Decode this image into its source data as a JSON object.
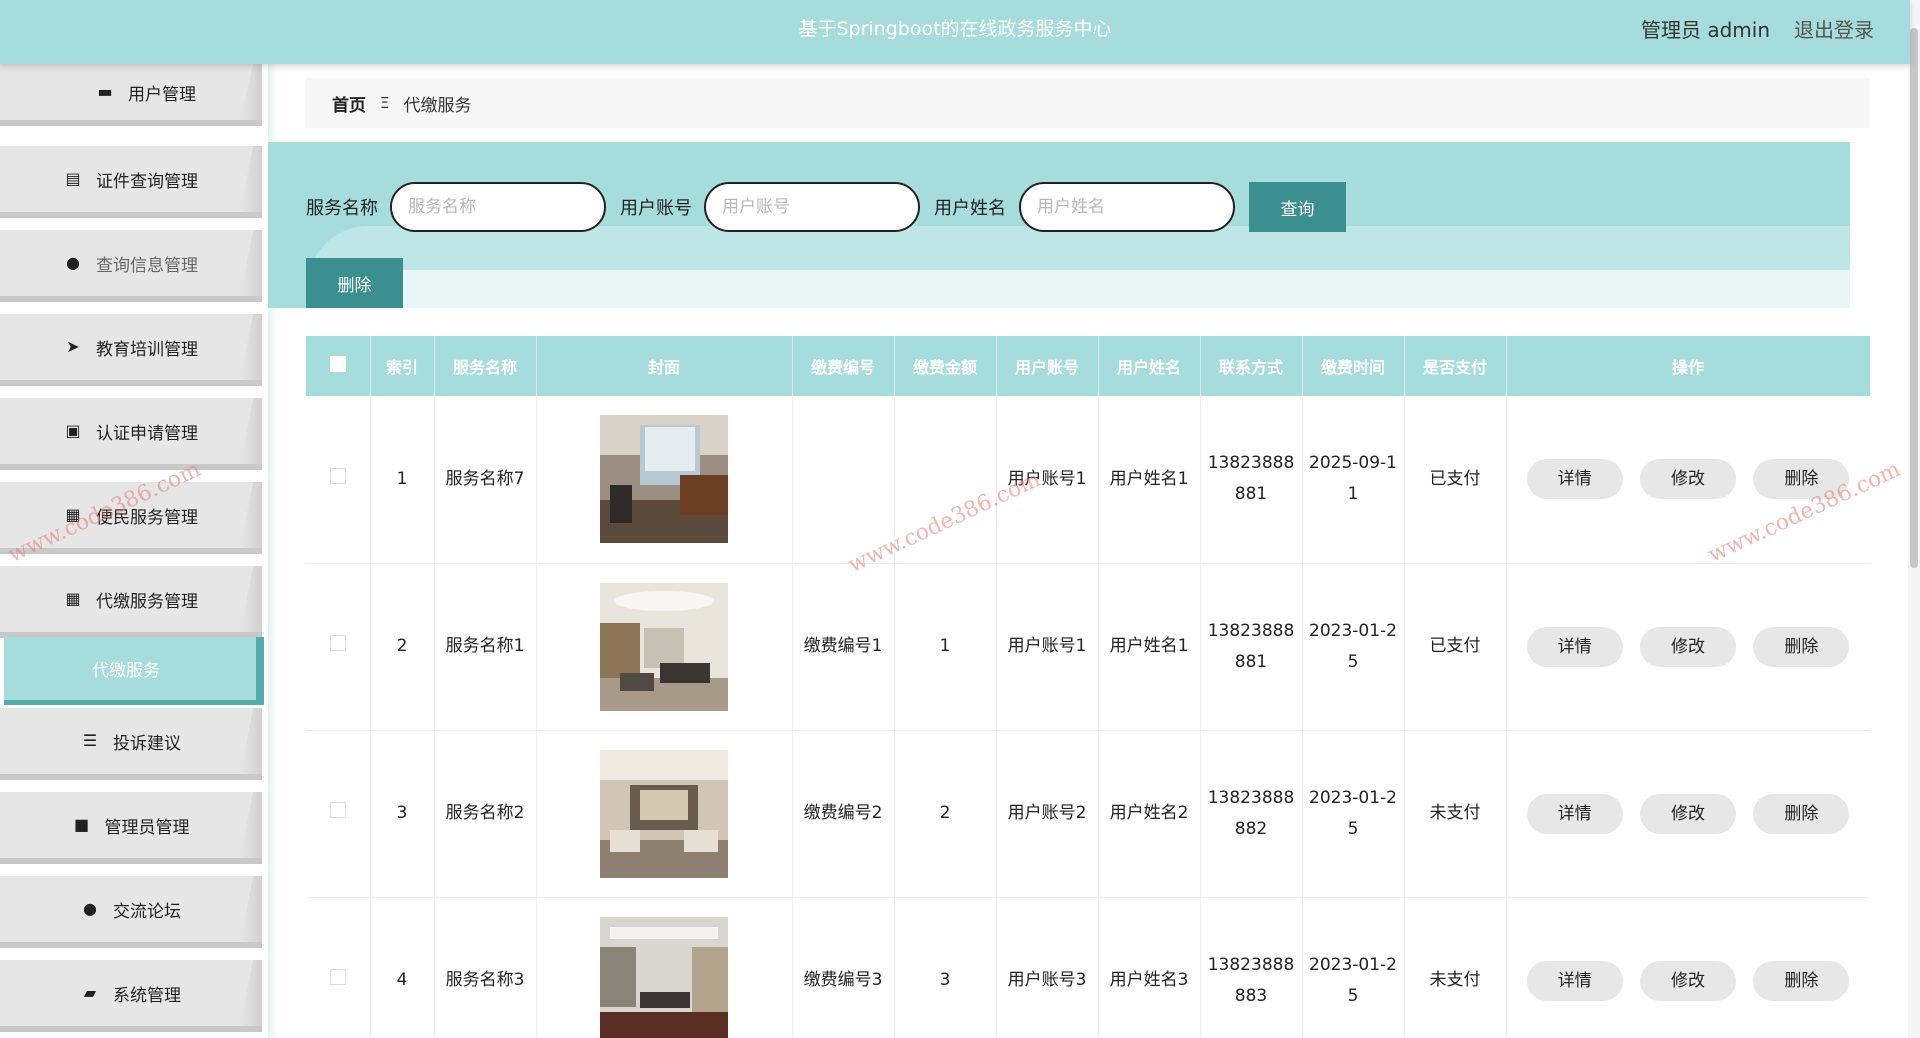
{
  "header": {
    "title": "基于Springboot的在线政务服务中心",
    "user": "管理员 admin",
    "logout": "退出登录"
  },
  "sidebar": {
    "items": [
      {
        "label": "用户管理",
        "icon": "comment-icon"
      },
      {
        "label": "证件查询管理",
        "icon": "clipboard-icon"
      },
      {
        "label": "查询信息管理",
        "icon": "user-icon"
      },
      {
        "label": "教育培训管理",
        "icon": "send-icon"
      },
      {
        "label": "认证申请管理",
        "icon": "clipboard-x-icon"
      },
      {
        "label": "便民服务管理",
        "icon": "grid-icon"
      },
      {
        "label": "代缴服务管理",
        "icon": "grid-icon"
      },
      {
        "label": "投诉建议",
        "icon": "sliders-icon"
      },
      {
        "label": "管理员管理",
        "icon": "briefcase-icon"
      },
      {
        "label": "交流论坛",
        "icon": "user-icon"
      },
      {
        "label": "系统管理",
        "icon": "wallet-icon"
      }
    ],
    "active_sub": "代缴服务"
  },
  "breadcrumb": {
    "home": "首页",
    "separator": "Ξ",
    "current": "代缴服务"
  },
  "search": {
    "service_label": "服务名称",
    "service_placeholder": "服务名称",
    "account_label": "用户账号",
    "account_placeholder": "用户账号",
    "name_label": "用户姓名",
    "name_placeholder": "用户姓名",
    "query_button": "查询",
    "delete_button": "删除"
  },
  "table": {
    "headers": [
      "索引",
      "服务名称",
      "封面",
      "缴费编号",
      "缴费金额",
      "用户账号",
      "用户姓名",
      "联系方式",
      "缴费时间",
      "是否支付",
      "操作"
    ],
    "rows": [
      {
        "index": "1",
        "service": "服务名称7",
        "fee_no": "",
        "amount": "",
        "account": "用户账号1",
        "name": "用户姓名1",
        "phone": "13823888881",
        "time": "2025-09-11",
        "paid": "已支付"
      },
      {
        "index": "2",
        "service": "服务名称1",
        "fee_no": "缴费编号1",
        "amount": "1",
        "account": "用户账号1",
        "name": "用户姓名1",
        "phone": "13823888881",
        "time": "2023-01-25",
        "paid": "已支付"
      },
      {
        "index": "3",
        "service": "服务名称2",
        "fee_no": "缴费编号2",
        "amount": "2",
        "account": "用户账号2",
        "name": "用户姓名2",
        "phone": "13823888882",
        "time": "2023-01-25",
        "paid": "未支付"
      },
      {
        "index": "4",
        "service": "服务名称3",
        "fee_no": "缴费编号3",
        "amount": "3",
        "account": "用户账号3",
        "name": "用户姓名3",
        "phone": "13823888883",
        "time": "2023-01-25",
        "paid": "未支付"
      }
    ],
    "actions": {
      "detail": "详情",
      "edit": "修改",
      "delete": "删除"
    }
  },
  "watermark": "www.code386.com",
  "colors": {
    "accent": "#a7dcdc",
    "button": "#3c8f8f",
    "sidebar_bg": "#e6e6e6"
  }
}
